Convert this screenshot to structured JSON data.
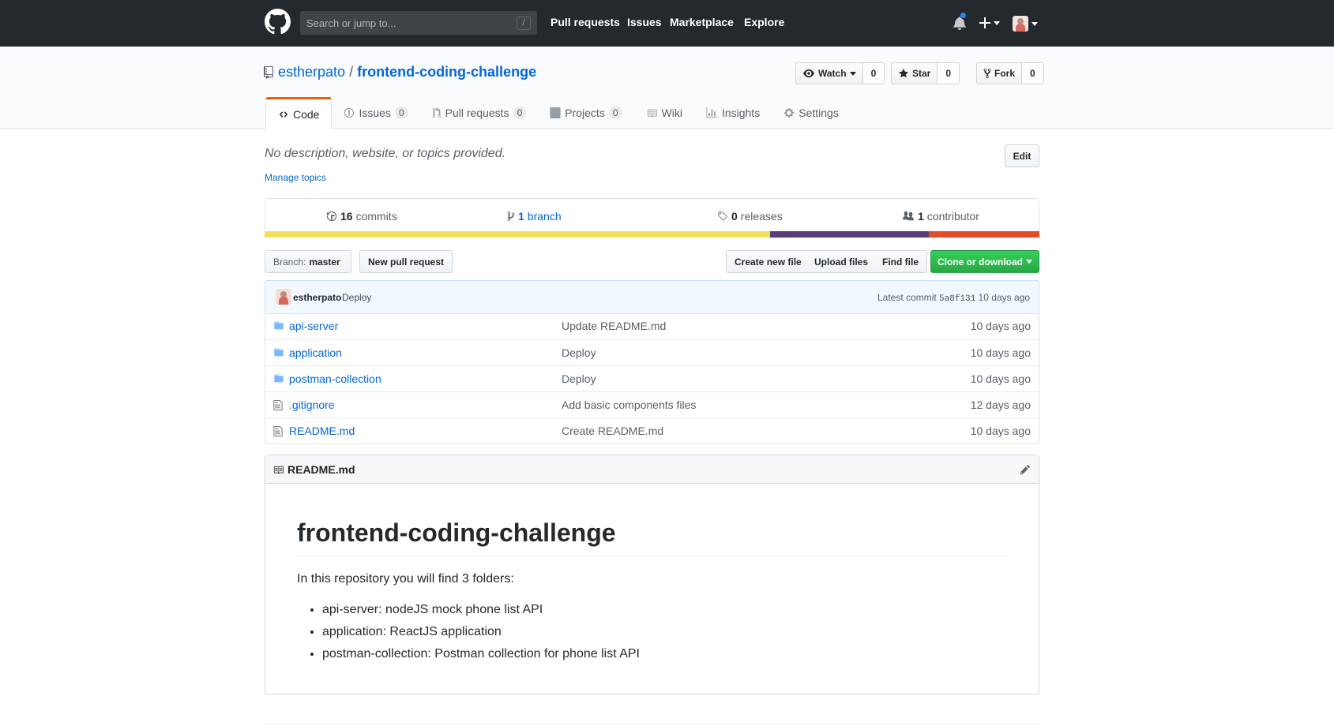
{
  "header": {
    "search_placeholder": "Search or jump to...",
    "search_key": "/",
    "nav": [
      "Pull requests",
      "Issues",
      "Marketplace",
      "Explore"
    ]
  },
  "repo": {
    "owner": "estherpato",
    "separator": "/",
    "name": "frontend-coding-challenge",
    "watch_label": "Watch",
    "watch_count": "0",
    "star_label": "Star",
    "star_count": "0",
    "fork_label": "Fork",
    "fork_count": "0"
  },
  "tabs": [
    {
      "label": "Code",
      "icon": "code-icon",
      "selected": true
    },
    {
      "label": "Issues",
      "icon": "issue-icon",
      "count": "0"
    },
    {
      "label": "Pull requests",
      "icon": "pull-request-icon",
      "count": "0"
    },
    {
      "label": "Projects",
      "icon": "project-icon",
      "count": "0"
    },
    {
      "label": "Wiki",
      "icon": "book-icon"
    },
    {
      "label": "Insights",
      "icon": "graph-icon"
    },
    {
      "label": "Settings",
      "icon": "gear-icon"
    }
  ],
  "description": {
    "text": "No description, website, or topics provided.",
    "manage_topics": "Manage topics",
    "edit_label": "Edit"
  },
  "summary": {
    "commits_count": "16",
    "commits_label": "commits",
    "branch_count": "1",
    "branch_label": "branch",
    "releases_count": "0",
    "releases_label": "releases",
    "contributors_count": "1",
    "contributors_label": "contributor"
  },
  "languages": [
    {
      "color": "#f1e05a",
      "percent": 65.2
    },
    {
      "color": "#563d7c",
      "percent": 20.5
    },
    {
      "color": "#e34c26",
      "percent": 14.3
    }
  ],
  "file_nav": {
    "branch_prefix": "Branch:",
    "branch_name": "master",
    "new_pr": "New pull request",
    "create_file": "Create new file",
    "upload_files": "Upload files",
    "find_file": "Find file",
    "clone": "Clone or download"
  },
  "latest_commit": {
    "author": "estherpato",
    "message": "Deploy",
    "prefix": "Latest commit",
    "sha": "5a8f131",
    "age": "10 days ago"
  },
  "files": [
    {
      "type": "dir",
      "name": "api-server",
      "message": "Update README.md",
      "age": "10 days ago"
    },
    {
      "type": "dir",
      "name": "application",
      "message": "Deploy",
      "age": "10 days ago"
    },
    {
      "type": "dir",
      "name": "postman-collection",
      "message": "Deploy",
      "age": "10 days ago"
    },
    {
      "type": "file",
      "name": ".gitignore",
      "message": "Add basic components files",
      "age": "12 days ago"
    },
    {
      "type": "file",
      "name": "README.md",
      "message": "Create README.md",
      "age": "10 days ago"
    }
  ],
  "readme": {
    "filename": "README.md",
    "heading": "frontend-coding-challenge",
    "intro": "In this repository you will find 3 folders:",
    "items": [
      "api-server: nodeJS mock phone list API",
      "application: ReactJS application",
      "postman-collection: Postman collection for phone list API"
    ]
  },
  "colors": {
    "header_bg": "#24292e",
    "link": "#0366d6",
    "tab_accent": "#e36209",
    "clone_green": "#28a745",
    "notification_dot": "#2188ff"
  }
}
